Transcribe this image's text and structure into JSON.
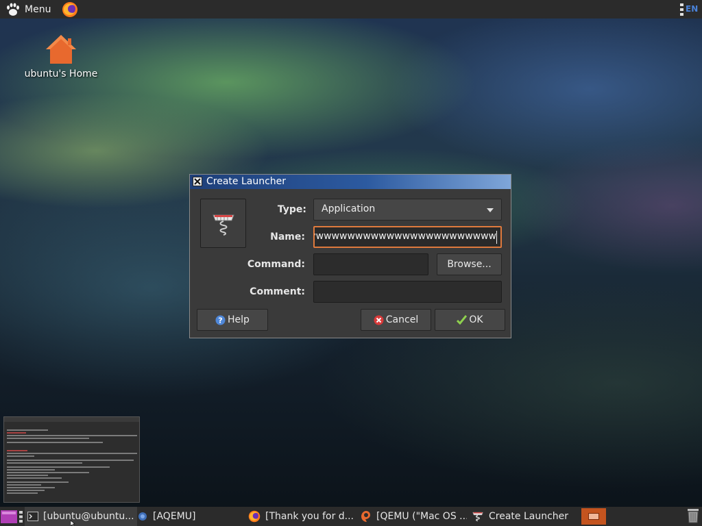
{
  "top_panel": {
    "menu_label": "Menu",
    "lang_indicator": "EN"
  },
  "desktop": {
    "home_icon_label": "ubuntu's Home"
  },
  "dialog": {
    "title": "Create Launcher",
    "type_label": "Type:",
    "type_value": "Application",
    "name_label": "Name:",
    "name_value": "vwwwwwwwwwwwwwwwwwwwwwww",
    "command_label": "Command:",
    "command_value": "",
    "browse_button": "Browse...",
    "comment_label": "Comment:",
    "comment_value": "",
    "help_button": "Help",
    "cancel_button": "Cancel",
    "ok_button": "OK"
  },
  "taskbar": {
    "tasks": [
      {
        "label": "[ubuntu@ubuntu..."
      },
      {
        "label": "[AQEMU]"
      },
      {
        "label": "[Thank you for d..."
      },
      {
        "label": "[QEMU (\"Mac OS ..."
      },
      {
        "label": "Create Launcher"
      }
    ]
  },
  "colors": {
    "focus_border": "#e07a3d",
    "title_gradient_start": "#1e3f79",
    "workspace_active": "#c4541f"
  }
}
